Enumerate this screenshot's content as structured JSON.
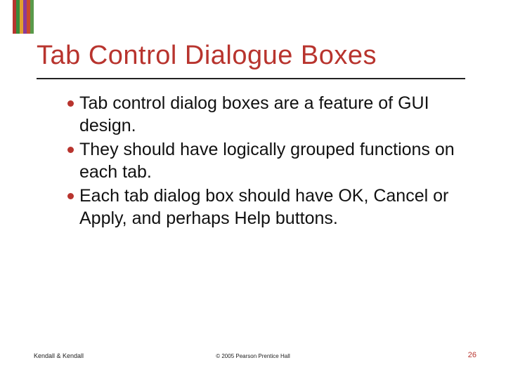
{
  "title": "Tab Control Dialogue Boxes",
  "bullets": [
    "Tab control dialog boxes are a feature of GUI design.",
    "They should have logically grouped functions on each tab.",
    "Each tab dialog box should have OK, Cancel or Apply, and perhaps Help buttons."
  ],
  "footer": {
    "left": "Kendall & Kendall",
    "center": "© 2005 Pearson Prentice Hall",
    "right": "26"
  },
  "colors": {
    "accent": "#b8342e"
  }
}
